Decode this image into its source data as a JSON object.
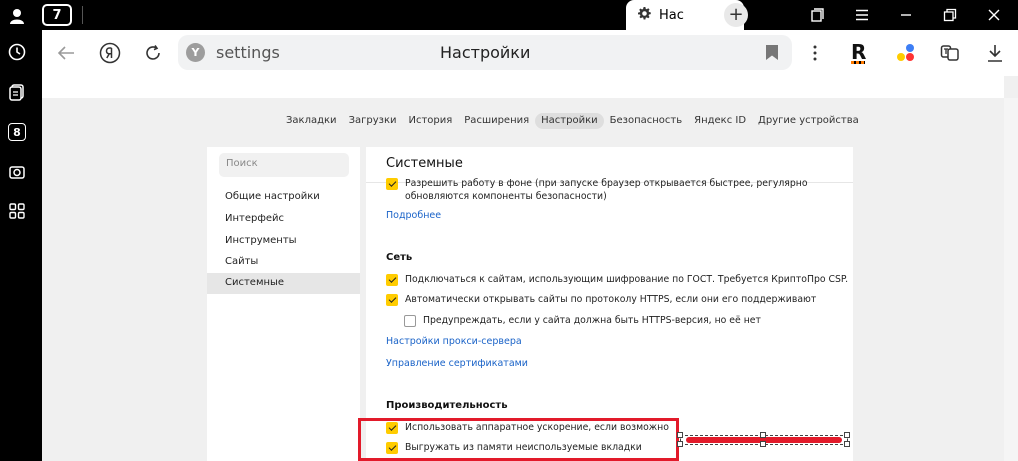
{
  "tabs": {
    "tab_count": "7",
    "active_tab_title": "Нас",
    "new_tab": "+"
  },
  "toolbar": {
    "url": "settings",
    "page_title": "Настройки",
    "extension_r": "R"
  },
  "sidebar_nav": {
    "badge": "8"
  },
  "top_nav": {
    "items": [
      "Закладки",
      "Загрузки",
      "История",
      "Расширения",
      "Настройки",
      "Безопасность",
      "Яндекс ID",
      "Другие устройства"
    ],
    "active_index": 4
  },
  "menu": {
    "search_placeholder": "Поиск",
    "items": [
      "Общие настройки",
      "Интерфейс",
      "Инструменты",
      "Сайты",
      "Системные"
    ],
    "active_index": 4
  },
  "content": {
    "title": "Системные",
    "background": {
      "option": "Разрешить работу в фоне (при запуске браузер открывается быстрее, регулярно обновляются компоненты безопасности)",
      "option_line1": "Разрешить работу в фоне (при запуске браузер открывается быстрее, регулярно",
      "option_line2": "обновляются компоненты безопасности)",
      "checked": true,
      "more_link": "Подробнее"
    },
    "network": {
      "title": "Сеть",
      "gost": "Подключаться к сайтам, использующим шифрование по ГОСТ. Требуется КриптоПро CSP.",
      "gost_checked": true,
      "https": "Автоматически открывать сайты по протоколу HTTPS, если они его поддерживают",
      "https_checked": true,
      "warn": "Предупреждать, если у сайта должна быть HTTPS-версия, но её нет",
      "warn_checked": false,
      "proxy_link": "Настройки прокси-сервера",
      "certs_link": "Управление сертификатами"
    },
    "performance": {
      "title": "Производительность",
      "hw_accel": "Использовать аппаратное ускорение, если возможно",
      "hw_accel_checked": true,
      "unload_tabs": "Выгружать из памяти неиспользуемые вкладки",
      "unload_tabs_checked": true
    }
  },
  "colors": {
    "accent_checkbox": "#ffcc00",
    "link": "#1a63c8",
    "annotation": "#e21a2a"
  }
}
